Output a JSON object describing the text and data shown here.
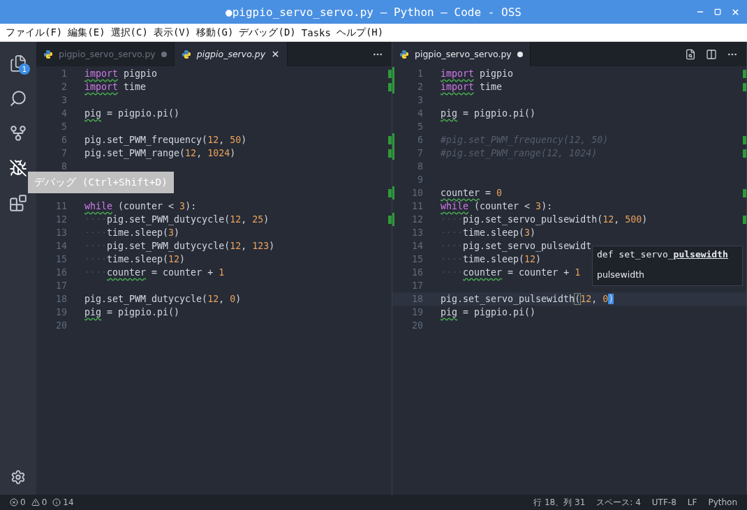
{
  "window": {
    "title": "●pigpio_servo_servo.py — Python — Code - OSS"
  },
  "menu": [
    "ファイル(F)",
    "編集(E)",
    "選択(C)",
    "表示(V)",
    "移動(G)",
    "デバッグ(D)",
    "Tasks",
    "ヘルプ(H)"
  ],
  "activity_bar": {
    "items": [
      {
        "kind": "files",
        "badge": "1"
      },
      {
        "kind": "search"
      },
      {
        "kind": "source-control"
      },
      {
        "kind": "debug"
      },
      {
        "kind": "extensions"
      }
    ],
    "tooltip": "デバッグ (Ctrl+Shift+D)"
  },
  "editor_groups": [
    {
      "focused": false,
      "tabs": [
        {
          "label": "pigpio_servo_servo.py",
          "selected": false,
          "preview": false,
          "dirty": true
        },
        {
          "label": "pigpio_servo.py",
          "selected": true,
          "preview": true,
          "dirty": false
        }
      ],
      "lines": [
        {
          "number": "1",
          "changed": true,
          "tokens": [
            {
              "kind": "keyword",
              "text": "import",
              "squiggle": true
            },
            {
              "kind": "plain",
              "text": " pigpio"
            }
          ]
        },
        {
          "number": "2",
          "changed": true,
          "tokens": [
            {
              "kind": "keyword",
              "text": "import",
              "squiggle": true
            },
            {
              "kind": "plain",
              "text": " time"
            }
          ]
        },
        {
          "number": "3"
        },
        {
          "number": "4",
          "tokens": [
            {
              "kind": "plain",
              "text": "pig",
              "squiggle": true
            },
            {
              "kind": "plain",
              "text": " = pigpio.pi()"
            }
          ]
        },
        {
          "number": "5"
        },
        {
          "number": "6",
          "changed": true,
          "tokens": [
            {
              "kind": "plain",
              "text": "pig.set_PWM_frequency("
            },
            {
              "kind": "number",
              "text": "12"
            },
            {
              "kind": "plain",
              "text": ", "
            },
            {
              "kind": "number",
              "text": "50"
            },
            {
              "kind": "plain",
              "text": ")"
            }
          ]
        },
        {
          "number": "7",
          "changed": true,
          "tokens": [
            {
              "kind": "plain",
              "text": "pig.set_PWM_range("
            },
            {
              "kind": "number",
              "text": "12"
            },
            {
              "kind": "plain",
              "text": ", "
            },
            {
              "kind": "number",
              "text": "1024"
            },
            {
              "kind": "plain",
              "text": ")"
            }
          ]
        },
        {
          "number": "8"
        },
        {
          "changed": true,
          "covered": true
        },
        {
          "number": "11",
          "tokens": [
            {
              "kind": "keyword",
              "text": "while",
              "squiggle": true
            },
            {
              "kind": "plain",
              "text": " (counter < "
            },
            {
              "kind": "number",
              "text": "3"
            },
            {
              "kind": "plain",
              "text": "):"
            }
          ]
        },
        {
          "number": "12",
          "changed": true,
          "tokens": [
            {
              "kind": "whitespace",
              "text": "····"
            },
            {
              "kind": "plain",
              "text": "pig.set_PWM_dutycycle("
            },
            {
              "kind": "number",
              "text": "12"
            },
            {
              "kind": "plain",
              "text": ", "
            },
            {
              "kind": "number",
              "text": "25"
            },
            {
              "kind": "plain",
              "text": ")"
            }
          ]
        },
        {
          "number": "13",
          "tokens": [
            {
              "kind": "whitespace",
              "text": "····"
            },
            {
              "kind": "plain",
              "text": "time.sleep("
            },
            {
              "kind": "number",
              "text": "3"
            },
            {
              "kind": "plain",
              "text": ")"
            }
          ]
        },
        {
          "number": "14",
          "tokens": [
            {
              "kind": "whitespace",
              "text": "····"
            },
            {
              "kind": "plain",
              "text": "pig.set_PWM_dutycycle("
            },
            {
              "kind": "number",
              "text": "12"
            },
            {
              "kind": "plain",
              "text": ", "
            },
            {
              "kind": "number",
              "text": "123"
            },
            {
              "kind": "plain",
              "text": ")"
            }
          ]
        },
        {
          "number": "15",
          "tokens": [
            {
              "kind": "whitespace",
              "text": "····"
            },
            {
              "kind": "plain",
              "text": "time.sleep("
            },
            {
              "kind": "number",
              "text": "12"
            },
            {
              "kind": "plain",
              "text": ")"
            }
          ]
        },
        {
          "number": "16",
          "tokens": [
            {
              "kind": "whitespace",
              "text": "····"
            },
            {
              "kind": "plain",
              "text": "counter",
              "squiggle": true
            },
            {
              "kind": "plain",
              "text": " = counter + "
            },
            {
              "kind": "number",
              "text": "1"
            }
          ]
        },
        {
          "number": "17"
        },
        {
          "number": "18",
          "tokens": [
            {
              "kind": "plain",
              "text": "pig.set_PWM_dutycycle("
            },
            {
              "kind": "number",
              "text": "12"
            },
            {
              "kind": "plain",
              "text": ", "
            },
            {
              "kind": "number",
              "text": "0"
            },
            {
              "kind": "plain",
              "text": ")"
            }
          ]
        },
        {
          "number": "19",
          "tokens": [
            {
              "kind": "plain",
              "text": "pig",
              "squiggle": true
            },
            {
              "kind": "plain",
              "text": " = pigpio.pi()"
            }
          ]
        },
        {
          "number": "20"
        }
      ]
    },
    {
      "focused": true,
      "tabs": [
        {
          "label": "pigpio_servo_servo.py",
          "selected": true,
          "preview": false,
          "dirty": true
        }
      ],
      "lines": [
        {
          "number": "1",
          "changed": true,
          "tokens": [
            {
              "kind": "keyword",
              "text": "import",
              "squiggle": true
            },
            {
              "kind": "plain",
              "text": " pigpio"
            }
          ]
        },
        {
          "number": "2",
          "changed": true,
          "tokens": [
            {
              "kind": "keyword",
              "text": "import",
              "squiggle": true
            },
            {
              "kind": "plain",
              "text": " time"
            }
          ]
        },
        {
          "number": "3"
        },
        {
          "number": "4",
          "tokens": [
            {
              "kind": "plain",
              "text": "pig",
              "squiggle": true
            },
            {
              "kind": "plain",
              "text": " = pigpio.pi()"
            }
          ]
        },
        {
          "number": "5"
        },
        {
          "number": "6",
          "changed": true,
          "tokens": [
            {
              "kind": "comment",
              "text": "#pig.set_PWM_frequency(12, 50)"
            }
          ]
        },
        {
          "number": "7",
          "changed": true,
          "tokens": [
            {
              "kind": "comment",
              "text": "#pig.set_PWM_range(12, 1024)"
            }
          ]
        },
        {
          "number": "8"
        },
        {
          "number": "9"
        },
        {
          "number": "10",
          "changed": true,
          "tokens": [
            {
              "kind": "plain",
              "text": "counter",
              "squiggle": true
            },
            {
              "kind": "plain",
              "text": " = "
            },
            {
              "kind": "number",
              "text": "0"
            }
          ]
        },
        {
          "number": "11",
          "tokens": [
            {
              "kind": "keyword",
              "text": "while",
              "squiggle": true
            },
            {
              "kind": "plain",
              "text": " (counter < "
            },
            {
              "kind": "number",
              "text": "3"
            },
            {
              "kind": "plain",
              "text": "):"
            }
          ]
        },
        {
          "number": "12",
          "changed": true,
          "tokens": [
            {
              "kind": "whitespace",
              "text": "····"
            },
            {
              "kind": "plain",
              "text": "pig.set_servo_pulsewidth("
            },
            {
              "kind": "number",
              "text": "12"
            },
            {
              "kind": "plain",
              "text": ", "
            },
            {
              "kind": "number",
              "text": "500"
            },
            {
              "kind": "plain",
              "text": ")"
            }
          ]
        },
        {
          "number": "13",
          "tokens": [
            {
              "kind": "whitespace",
              "text": "····"
            },
            {
              "kind": "plain",
              "text": "time.sleep("
            },
            {
              "kind": "number",
              "text": "3"
            },
            {
              "kind": "plain",
              "text": ")"
            }
          ]
        },
        {
          "number": "14",
          "tokens": [
            {
              "kind": "whitespace",
              "text": "····"
            },
            {
              "kind": "plain",
              "text": "pig.set_servo_pulsewidt"
            }
          ]
        },
        {
          "number": "15",
          "tokens": [
            {
              "kind": "whitespace",
              "text": "····"
            },
            {
              "kind": "plain",
              "text": "time.sleep("
            },
            {
              "kind": "number",
              "text": "12"
            },
            {
              "kind": "plain",
              "text": ")"
            }
          ]
        },
        {
          "number": "16",
          "tokens": [
            {
              "kind": "whitespace",
              "text": "····"
            },
            {
              "kind": "plain",
              "text": "counter",
              "squiggle": true
            },
            {
              "kind": "plain",
              "text": " = counter + "
            },
            {
              "kind": "number",
              "text": "1"
            }
          ]
        },
        {
          "number": "17"
        },
        {
          "number": "18",
          "current": true,
          "tokens": [
            {
              "kind": "plain",
              "text": "pig.set_servo_pulsewidth"
            },
            {
              "kind": "plain",
              "text": "(",
              "match": true
            },
            {
              "kind": "number",
              "text": "12"
            },
            {
              "kind": "plain",
              "text": ", "
            },
            {
              "kind": "number",
              "text": "0"
            },
            {
              "kind": "plain",
              "text": ")",
              "cursor": true
            }
          ]
        },
        {
          "number": "19",
          "tokens": [
            {
              "kind": "plain",
              "text": "pig",
              "squiggle": true
            },
            {
              "kind": "plain",
              "text": " = pigpio.pi()"
            }
          ]
        },
        {
          "number": "20"
        }
      ],
      "hover": {
        "signature": "def set_servo_**pulsewidth**",
        "doc": "pulsewidth"
      }
    }
  ],
  "status_bar": {
    "problems": [
      {
        "kind": "error",
        "count": "0"
      },
      {
        "kind": "warning",
        "count": "0"
      },
      {
        "kind": "info",
        "count": "14"
      }
    ],
    "items": [
      "行 18、列 31",
      "スペース: 4",
      "UTF-8",
      "LF",
      "Python"
    ]
  }
}
